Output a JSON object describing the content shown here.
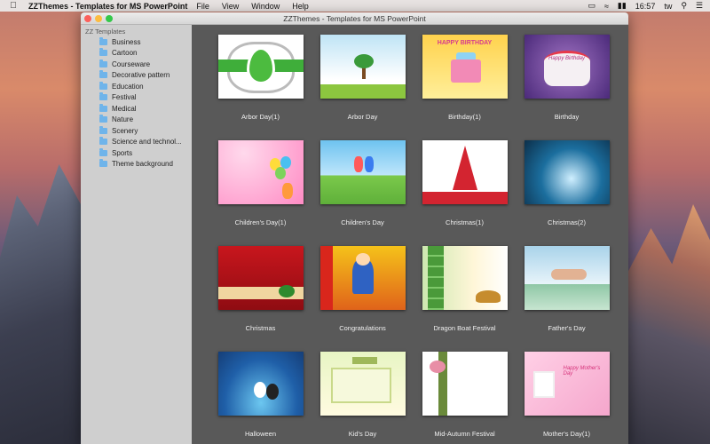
{
  "menubar": {
    "app_name": "ZZThemes - Templates for MS PowerPoint",
    "menus": [
      "File",
      "View",
      "Window",
      "Help"
    ],
    "time": "16:57",
    "user": "tw",
    "icons": [
      "apple-icon",
      "airplay-icon",
      "wifi-icon",
      "battery-icon",
      "search-icon",
      "list-icon"
    ]
  },
  "window": {
    "title": "ZZThemes - Templates for MS PowerPoint"
  },
  "sidebar": {
    "root": "ZZ Templates",
    "items": [
      {
        "label": "Business"
      },
      {
        "label": "Cartoon"
      },
      {
        "label": "Courseware"
      },
      {
        "label": "Decorative pattern"
      },
      {
        "label": "Education"
      },
      {
        "label": "Festival"
      },
      {
        "label": "Medical"
      },
      {
        "label": "Nature"
      },
      {
        "label": "Scenery"
      },
      {
        "label": "Science and technol..."
      },
      {
        "label": "Sports"
      },
      {
        "label": "Theme background"
      }
    ]
  },
  "templates": [
    {
      "label": "Arbor Day(1)"
    },
    {
      "label": "Arbor Day"
    },
    {
      "label": "Birthday(1)"
    },
    {
      "label": "Birthday"
    },
    {
      "label": "Children's Day(1)"
    },
    {
      "label": "Children's Day"
    },
    {
      "label": "Christmas(1)"
    },
    {
      "label": "Christmas(2)"
    },
    {
      "label": "Christmas"
    },
    {
      "label": "Congratulations"
    },
    {
      "label": "Dragon Boat Festival"
    },
    {
      "label": "Father's Day"
    },
    {
      "label": "Halloween"
    },
    {
      "label": "Kid's Day"
    },
    {
      "label": "Mid-Autumn Festival"
    },
    {
      "label": "Mother's Day(1)"
    }
  ],
  "thumb_text": {
    "happy_birthday": "HAPPY BIRTHDAY",
    "birthday_script": "Happy Birthday",
    "mothers_script": "Happy Mother's Day"
  }
}
